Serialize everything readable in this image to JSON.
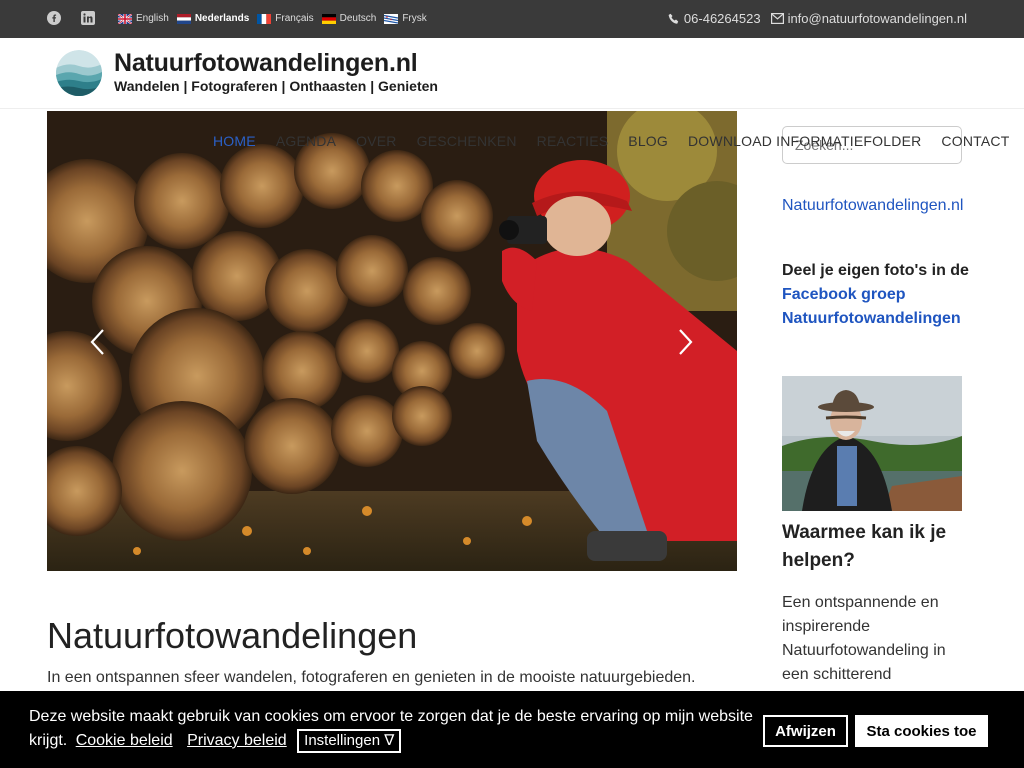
{
  "topbar": {
    "languages": [
      {
        "label": "English",
        "active": false
      },
      {
        "label": "Nederlands",
        "active": true
      },
      {
        "label": "Français",
        "active": false
      },
      {
        "label": "Deutsch",
        "active": false
      },
      {
        "label": "Frysk",
        "active": false
      }
    ],
    "phone": "06-46264523",
    "email": "info@natuurfotowandelingen.nl",
    "social_icons": [
      "facebook-icon",
      "linkedin-icon"
    ]
  },
  "header": {
    "title": "Natuurfotowandelingen.nl",
    "subtitle": "Wandelen | Fotograferen | Onthaasten | Genieten"
  },
  "nav": {
    "items": [
      "HOME",
      "AGENDA",
      "OVER",
      "GESCHENKEN",
      "REACTIES",
      "BLOG",
      "DOWNLOAD INFORMATIEFOLDER",
      "CONTACT"
    ]
  },
  "sidebar": {
    "search_placeholder": "Zoeken...",
    "site_link": "Natuurfotowandelingen.nl",
    "share_prefix": "Deel je eigen foto's in de",
    "share_link": "Facebook groep Natuurfotowandelingen",
    "help_heading": "Waarmee kan ik je helpen?",
    "help_text": "Een ontspannende en inspirerende Natuurfotowandeling in een schitterend"
  },
  "main": {
    "heading": "Natuurfotowandelingen",
    "intro": "In een ontspannen sfeer wandelen, fotograferen en genieten in de mooiste natuurgebieden."
  },
  "cookie": {
    "text": "Deze website maakt gebruik van cookies om ervoor te zorgen dat je de beste ervaring op mijn website krijgt.",
    "policy_link": "Cookie beleid",
    "privacy_link": "Privacy beleid",
    "settings_label": "Instellingen ∇",
    "reject_label": "Afwijzen",
    "accept_label": "Sta cookies toe"
  },
  "colors": {
    "topbar_bg": "#3a3a3a",
    "link_blue": "#1f55c0",
    "nav_active": "#2a60c7",
    "cookie_bg": "#000000"
  }
}
